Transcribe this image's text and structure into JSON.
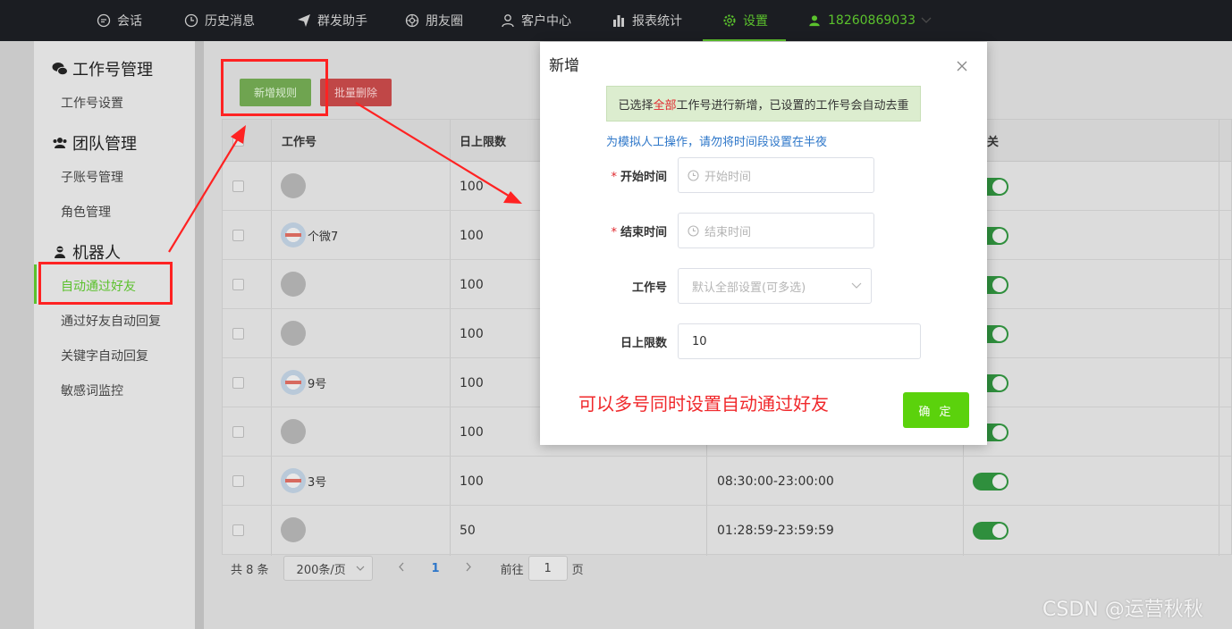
{
  "topnav": {
    "items": [
      {
        "label": "会话",
        "icon": "chat-icon"
      },
      {
        "label": "历史消息",
        "icon": "clock-icon"
      },
      {
        "label": "群发助手",
        "icon": "send-icon"
      },
      {
        "label": "朋友圈",
        "icon": "aperture-icon"
      },
      {
        "label": "客户中心",
        "icon": "user-icon"
      },
      {
        "label": "报表统计",
        "icon": "bar-chart-icon"
      },
      {
        "label": "设置",
        "icon": "gear-icon",
        "active": true
      }
    ],
    "user": "18260869033"
  },
  "sidebar": {
    "groups": [
      {
        "title": "工作号管理",
        "icon": "wechat-icon",
        "items": [
          "工作号设置"
        ]
      },
      {
        "title": "团队管理",
        "icon": "team-icon",
        "items": [
          "子账号管理",
          "角色管理"
        ]
      },
      {
        "title": "机器人",
        "icon": "robot-icon",
        "items": [
          "自动通过好友",
          "通过好友自动回复",
          "关键字自动回复",
          "敏感词监控"
        ]
      }
    ],
    "active_item": "自动通过好友"
  },
  "toolbar": {
    "add_label": "新增规则",
    "delete_label": "批量删除"
  },
  "table": {
    "columns": [
      "工作号",
      "日上限数",
      "关"
    ],
    "rows": [
      {
        "name": "",
        "avatar": "gray",
        "limit": "100",
        "time": ""
      },
      {
        "name": "个微7",
        "avatar": "img",
        "limit": "100",
        "time": ""
      },
      {
        "name": "",
        "avatar": "gray",
        "limit": "100",
        "time": ""
      },
      {
        "name": "",
        "avatar": "gray",
        "limit": "100",
        "time": ""
      },
      {
        "name": "9号",
        "avatar": "img",
        "limit": "100",
        "time": ""
      },
      {
        "name": "",
        "avatar": "gray",
        "limit": "100",
        "time": ""
      },
      {
        "name": "3号",
        "avatar": "img",
        "limit": "100",
        "time": "08:30:00-23:00:00"
      },
      {
        "name": "",
        "avatar": "gray",
        "limit": "50",
        "time": "01:28:59-23:59:59"
      }
    ]
  },
  "pager": {
    "total": "共 8 条",
    "page_size": "200条/页",
    "current": "1",
    "goto_prefix": "前往",
    "goto_value": "1",
    "goto_suffix": "页"
  },
  "modal": {
    "title": "新增",
    "notice_pre": "已选择",
    "notice_em": "全部",
    "notice_post": "工作号进行新增，已设置的工作号会自动去重",
    "tip": "为模拟人工操作，请勿将时间段设置在半夜",
    "fields": {
      "start": {
        "label": "开始时间",
        "placeholder": "开始时间"
      },
      "end": {
        "label": "结束时间",
        "placeholder": "结束时间"
      },
      "account": {
        "label": "工作号",
        "placeholder": "默认全部设置(可多选)"
      },
      "limit": {
        "label": "日上限数",
        "value": "10"
      }
    },
    "annotation": "可以多号同时设置自动通过好友",
    "confirm_label": "确 定"
  },
  "watermark": "CSDN @运营秋秋",
  "colors": {
    "accent": "#5bc12d",
    "annotation": "#f0282b",
    "topnav": "#1b1d22",
    "confirm": "#5bd20c"
  }
}
